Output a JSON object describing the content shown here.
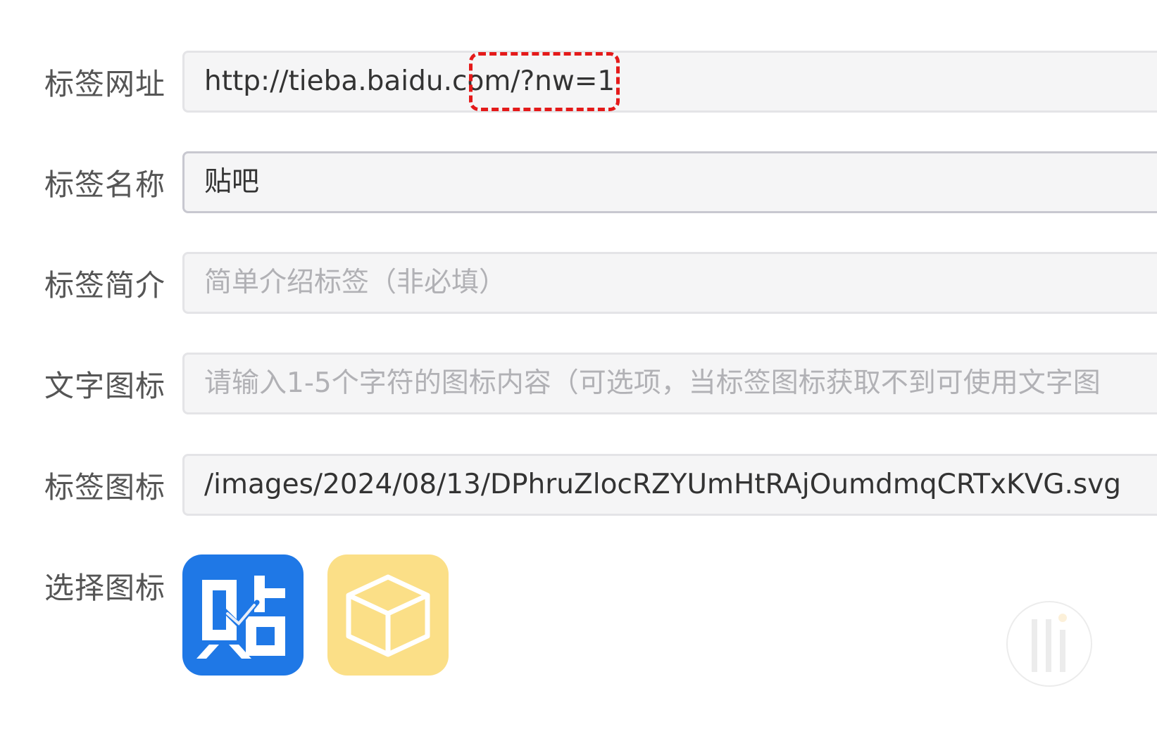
{
  "form": {
    "url": {
      "label": "标签网址",
      "value": "http://tieba.baidu.com/?nw=1"
    },
    "name": {
      "label": "标签名称",
      "value": "贴吧"
    },
    "intro": {
      "label": "标签简介",
      "placeholder": "简单介绍标签（非必填）"
    },
    "text_icon": {
      "label": "文字图标",
      "placeholder": "请输入1-5个字符的图标内容（可选项，当标签图标获取不到可使用文字图"
    },
    "icon_path": {
      "label": "标签图标",
      "value": "/images/2024/08/13/DPhruZlocRZYUmHtRAjOumdmqCRTxKVG.svg"
    },
    "choose_icon": {
      "label": "选择图标",
      "options": [
        {
          "icon": "tieba-logo-icon",
          "glyph": "贴",
          "background": "#1f78e6"
        },
        {
          "icon": "cube-icon",
          "background": "#fbdf87"
        }
      ]
    }
  },
  "annotation": {
    "color": "#e41a1a",
    "style": "dashed"
  }
}
